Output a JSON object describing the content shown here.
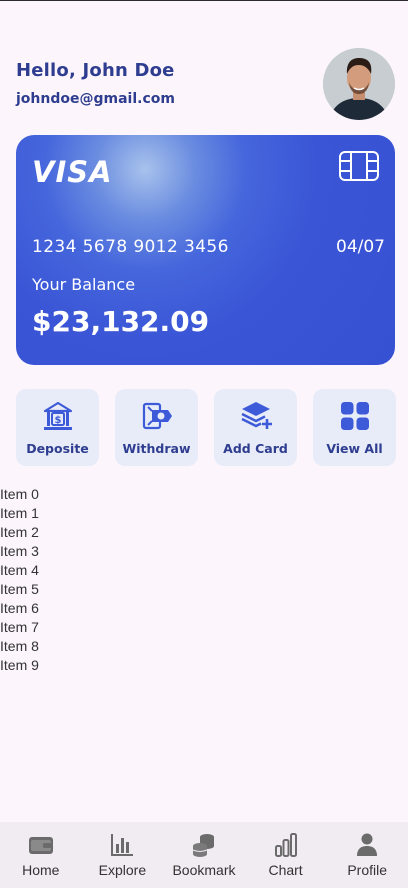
{
  "user": {
    "greeting": "Hello, John Doe",
    "email": "johndoe@gmail.com"
  },
  "card": {
    "brand": "VISA",
    "number": "1234 5678 9012 3456",
    "expiry": "04/07",
    "balance_label": "Your Balance",
    "balance": "$23,132.09"
  },
  "actions": [
    {
      "label": "Deposite",
      "icon": "bank-deposit-icon"
    },
    {
      "label": "Withdraw",
      "icon": "cash-withdraw-icon"
    },
    {
      "label": "Add Card",
      "icon": "add-card-stack-icon"
    },
    {
      "label": "View All",
      "icon": "grid-icon"
    }
  ],
  "items": [
    "Item 0",
    "Item 1",
    "Item 2",
    "Item 3",
    "Item 4",
    "Item 5",
    "Item 6",
    "Item 7",
    "Item 8",
    "Item 9"
  ],
  "nav": [
    {
      "label": "Home",
      "icon": "wallet-icon"
    },
    {
      "label": "Explore",
      "icon": "bar-chart-icon"
    },
    {
      "label": "Bookmark",
      "icon": "coins-icon"
    },
    {
      "label": "Chart",
      "icon": "signal-bars-icon"
    },
    {
      "label": "Profile",
      "icon": "person-icon"
    }
  ],
  "colors": {
    "accent": "#2e3d8f",
    "card": "#3a55d6",
    "icon": "#3d5ad8",
    "background": "#fcf6fc"
  }
}
